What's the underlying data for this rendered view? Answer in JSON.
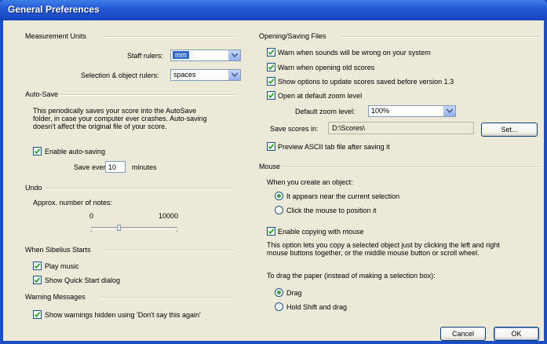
{
  "window": {
    "title": "General Preferences"
  },
  "measurement_units": {
    "heading": "Measurement Units",
    "staff_rulers_label": "Staff rulers:",
    "staff_rulers_value": "mm",
    "selection_rulers_label": "Selection & object rulers:",
    "selection_rulers_value": "spaces"
  },
  "auto_save": {
    "heading": "Auto-Save",
    "desc_lines": [
      "This periodically saves your score into the AutoSave",
      "folder, in case your computer ever crashes. Auto-saving",
      "doesn't affect the original file of your score."
    ],
    "enable_label": "Enable auto-saving",
    "enable_checked": true,
    "save_every_label": "Save every",
    "save_every_value": "10",
    "minutes_label": "minutes"
  },
  "undo": {
    "heading": "Undo",
    "approx_label": "Approx. number of notes:",
    "min_label": "0",
    "max_label": "10000",
    "slider_fraction": 0.32
  },
  "when_starts": {
    "heading": "When Sibelius Starts",
    "play_music_label": "Play music",
    "play_music_checked": true,
    "quick_start_label": "Show Quick Start dialog",
    "quick_start_checked": true
  },
  "warnings": {
    "heading": "Warning Messages",
    "show_hidden_label": "Show warnings hidden using 'Don't say this again'",
    "show_hidden_checked": true
  },
  "opening_saving": {
    "heading": "Opening/Saving Files",
    "warn_sounds_label": "Warn when sounds will be wrong on your system",
    "warn_old_label": "Warn when opening old scores",
    "show_options_label": "Show options to update scores saved before version 1.3",
    "open_zoom_label": "Open at default zoom level",
    "default_zoom_label": "Default zoom level:",
    "default_zoom_value": "100%",
    "save_in_label": "Save scores in:",
    "save_in_value": "D:\\Scores\\",
    "set_button": "Set...",
    "preview_ascii_label": "Preview ASCII tab file after saving it"
  },
  "mouse": {
    "heading": "Mouse",
    "create_object_label": "When you create an object:",
    "near_selection_label": "It appears near the current selection",
    "click_position_label": "Click the mouse to position it",
    "enable_copying_label": "Enable copying with mouse",
    "copy_desc_lines": [
      "This option lets you copy a selected object just by clicking the left and right",
      "mouse buttons together, or the middle mouse button or scroll wheel."
    ],
    "drag_paper_label": "To drag the paper (instead of making a selection box):",
    "drag_label": "Drag",
    "hold_shift_label": "Hold Shift and drag"
  },
  "buttons": {
    "cancel": "Cancel",
    "ok": "OK"
  }
}
